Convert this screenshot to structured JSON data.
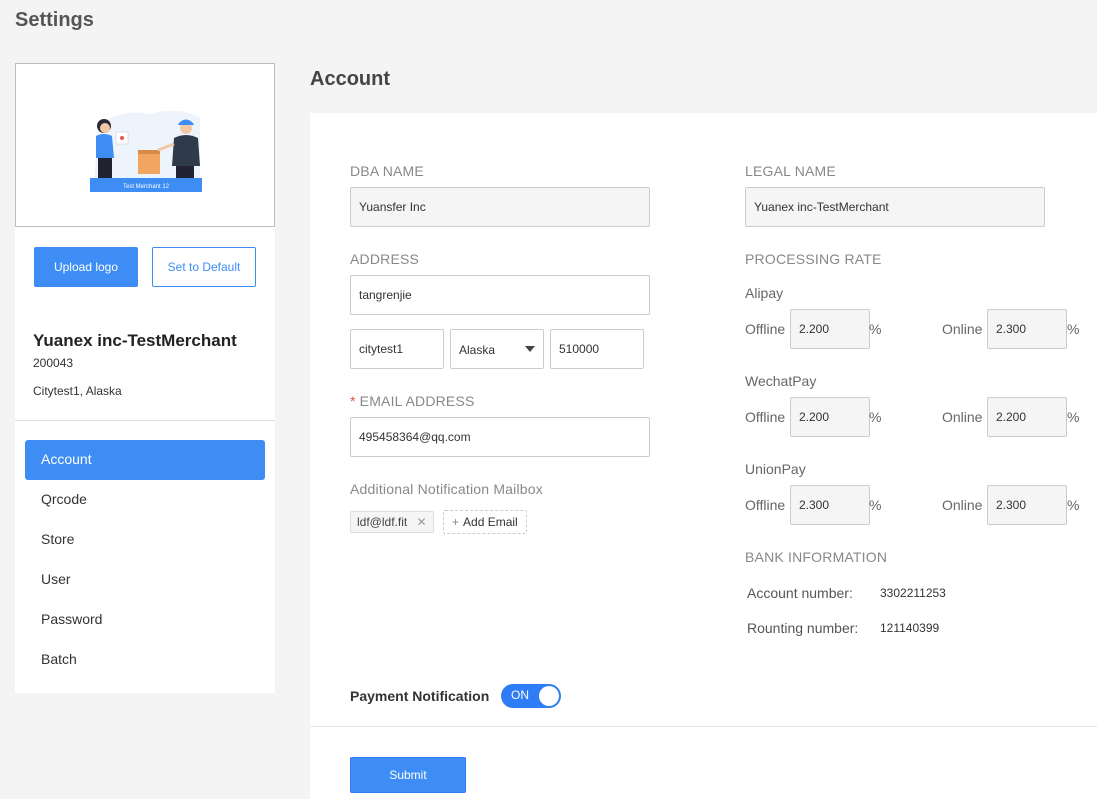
{
  "page": {
    "title": "Settings"
  },
  "profile": {
    "logo_caption": "Test Merchant 12",
    "upload_label": "Upload logo",
    "default_label": "Set to Default",
    "merchant_name": "Yuanex inc-TestMerchant",
    "merchant_id": "200043",
    "location": "Citytest1, Alaska"
  },
  "nav": {
    "items": [
      {
        "label": "Account",
        "active": true
      },
      {
        "label": "Qrcode",
        "active": false
      },
      {
        "label": "Store",
        "active": false
      },
      {
        "label": "User",
        "active": false
      },
      {
        "label": "Password",
        "active": false
      },
      {
        "label": "Batch",
        "active": false
      }
    ]
  },
  "account": {
    "title": "Account",
    "dba_label": "DBA NAME",
    "dba_value": "Yuansfer Inc",
    "legal_label": "LEGAL NAME",
    "legal_value": "Yuanex inc-TestMerchant",
    "address_label": "ADDRESS",
    "address_value": "tangrenjie",
    "city_value": "citytest1",
    "state_value": "Alaska",
    "zip_value": "510000",
    "email_label": "EMAIL ADDRESS",
    "email_value": "495458364@qq.com",
    "additional_label": "Additional Notification Mailbox",
    "tag_email": "ldf@ldf.fit",
    "add_email_label": "Add Email",
    "pay_notif_label": "Payment Notification",
    "toggle_text": "ON",
    "submit_label": "Submit"
  },
  "rates": {
    "label": "PROCESSING RATE",
    "offline_label": "Offline",
    "online_label": "Online",
    "percent": "%",
    "groups": [
      {
        "name": "Alipay",
        "offline": "2.200",
        "online": "2.300"
      },
      {
        "name": "WechatPay",
        "offline": "2.200",
        "online": "2.200"
      },
      {
        "name": "UnionPay",
        "offline": "2.300",
        "online": "2.300"
      }
    ]
  },
  "bank": {
    "label": "BANK INFORMATION",
    "account_key": "Account number:",
    "account_value": "3302211253",
    "routing_key": "Rounting number:",
    "routing_value": "121140399"
  },
  "colors": {
    "primary": "#3d8df5",
    "toggle": "#2e7cf6",
    "required": "#e5523f"
  }
}
